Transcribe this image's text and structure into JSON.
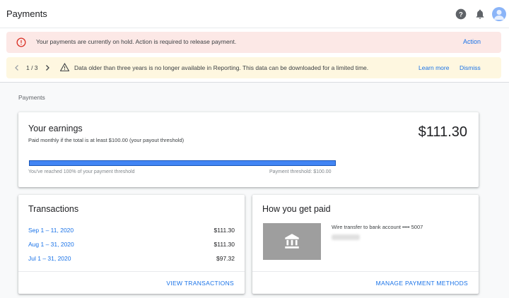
{
  "header": {
    "title": "Payments",
    "icons": [
      "help-icon",
      "notifications-icon",
      "account-avatar"
    ]
  },
  "alerts": {
    "error": {
      "message": "Your payments are currently on hold. Action is required to release payment.",
      "action_label": "Action"
    },
    "warning": {
      "pager": "1 / 3",
      "message": "Data older than three years is no longer available in Reporting. This data can be downloaded for a limited time.",
      "learn_more_label": "Learn more",
      "dismiss_label": "Dismiss"
    }
  },
  "breadcrumb": "Payments",
  "earnings": {
    "title": "Your earnings",
    "subtitle": "Paid monthly if the total is at least $100.00 (your payout threshold)",
    "amount": "$111.30",
    "progress_percent": 100,
    "reached_text": "You've reached 100% of your payment threshold",
    "threshold_text": "Payment threshold: $100.00"
  },
  "transactions": {
    "title": "Transactions",
    "rows": [
      {
        "date": "Sep 1 – 11, 2020",
        "amount": "$111.30"
      },
      {
        "date": "Aug 1 – 31, 2020",
        "amount": "$111.30"
      },
      {
        "date": "Jul 1 – 31, 2020",
        "amount": "$97.32"
      }
    ],
    "view_label": "VIEW TRANSACTIONS"
  },
  "how_paid": {
    "title": "How you get paid",
    "method": "Wire transfer to bank account •••• 5007",
    "manage_label": "MANAGE PAYMENT METHODS"
  },
  "colors": {
    "accent": "#1a73e8",
    "error_bg": "#fce8e6",
    "warning_bg": "#fef7e0",
    "progress": "#4285f4"
  }
}
